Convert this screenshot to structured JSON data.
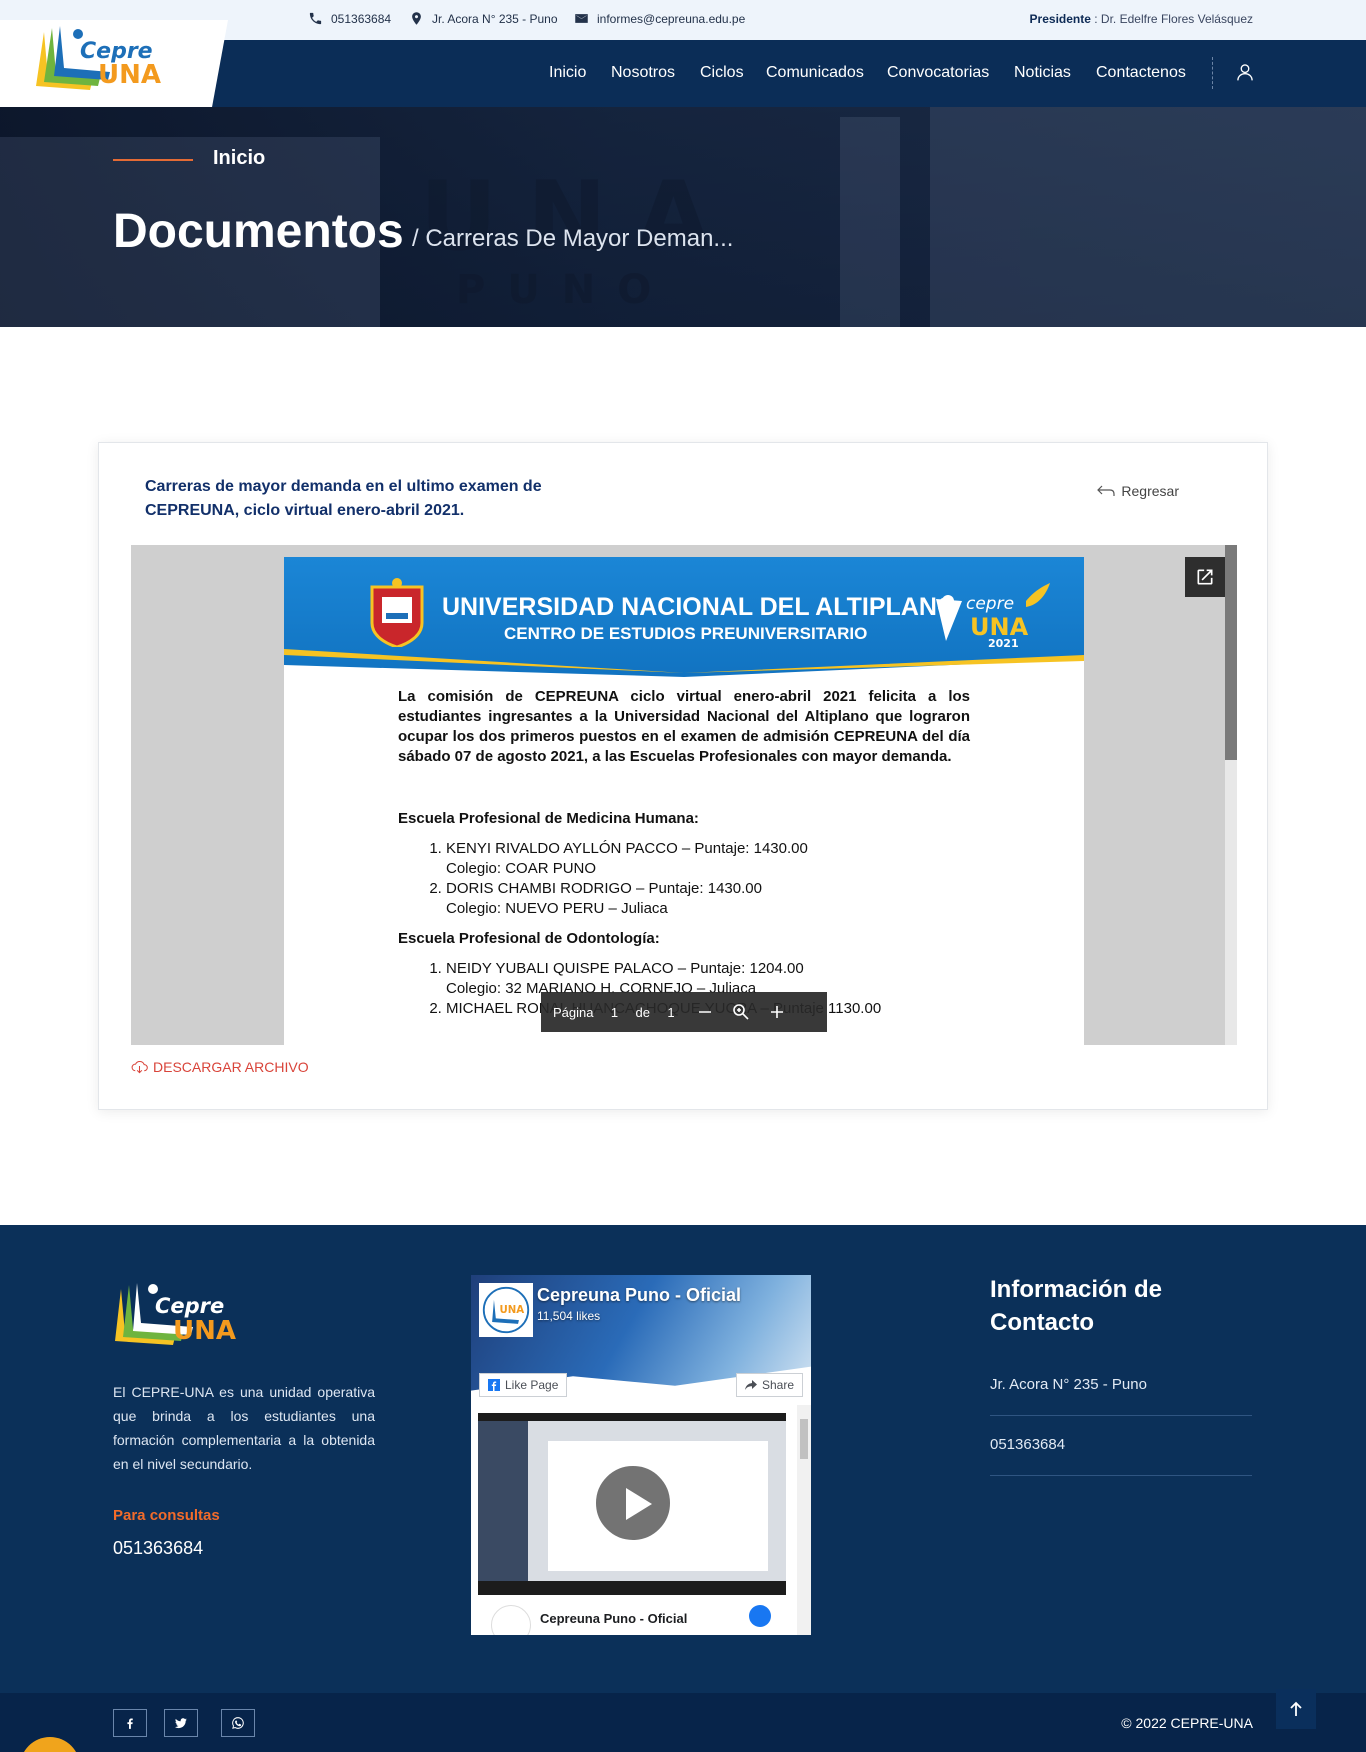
{
  "topbar": {
    "phone": "051363684",
    "address": "Jr. Acora N° 235 - Puno",
    "email": "informes@cepreuna.edu.pe",
    "president_label": "Presidente",
    "president_name": ": Dr. Edelfre Flores Velásquez"
  },
  "brand": {
    "logo_top": "Cepre",
    "logo_bottom": "UNA"
  },
  "nav": {
    "items": [
      "Inicio",
      "Nosotros",
      "Ciclos",
      "Comunicados",
      "Convocatorias",
      "Noticias",
      "Contactenos"
    ]
  },
  "hero": {
    "crumb": "Inicio",
    "title": "Documentos",
    "subtitle": "/ Carreras De Mayor Deman..."
  },
  "document": {
    "title": "Carreras de mayor demanda en el ultimo examen de CEPREUNA, ciclo virtual enero-abril 2021.",
    "back_label": "Regresar",
    "download_label": "DESCARGAR ARCHIVO"
  },
  "pdf": {
    "header_line1": "UNIVERSIDAD NACIONAL DEL ALTIPLANO",
    "header_line2": "CENTRO DE ESTUDIOS PREUNIVERSITARIO",
    "logo_year": "2021",
    "intro": "La comisión de CEPREUNA ciclo virtual enero-abril 2021 felicita a los estudiantes ingresantes a la Universidad Nacional del Altiplano que lograron ocupar los dos primeros puestos en el examen de admisión CEPREUNA del día sábado 07 de agosto 2021, a las Escuelas Profesionales con mayor demanda.",
    "schools": [
      {
        "name": "Escuela Profesional de Medicina Humana:",
        "students": [
          {
            "line": "KENYI RIVALDO AYLLÓN PACCO – Puntaje: 1430.00",
            "school": "Colegio: COAR PUNO"
          },
          {
            "line": "DORIS CHAMBI RODRIGO – Puntaje: 1430.00",
            "school": "Colegio: NUEVO PERU – Juliaca"
          }
        ]
      },
      {
        "name": "Escuela Profesional de Odontología:",
        "students": [
          {
            "line": "NEIDY YUBALI QUISPE PALACO – Puntaje: 1204.00",
            "school": "Colegio: 32 MARIANO H. CORNEJO – Juliaca"
          },
          {
            "line": "MICHAEL RONAL HUANCACHOQUE YUCRA – Puntaje 1130.00",
            "school": ""
          }
        ]
      }
    ],
    "toolbar": {
      "page_label": "Página",
      "page_current": "1",
      "of_label": "de",
      "page_total": "1"
    }
  },
  "footer": {
    "description": "El CEPRE-UNA es una unidad operativa que brinda a los estudiantes una formación complementaria a la obtenida en el nivel secundario.",
    "consult_label": "Para consultas",
    "consult_phone": "051363684",
    "facebook": {
      "page_name": "Cepreuna Puno - Oficial",
      "likes": "11,504 likes",
      "like_button": "Like Page",
      "share_button": "Share",
      "post_author": "Cepreuna Puno - Oficial"
    },
    "contact": {
      "title": "Información de Contacto",
      "address": "Jr. Acora N° 235 - Puno",
      "phone": "051363684"
    },
    "copyright": "© 2022 CEPRE-UNA"
  },
  "colors": {
    "navy": "#0b2d57",
    "accent": "#e46b35",
    "link_red": "#d9443a"
  }
}
